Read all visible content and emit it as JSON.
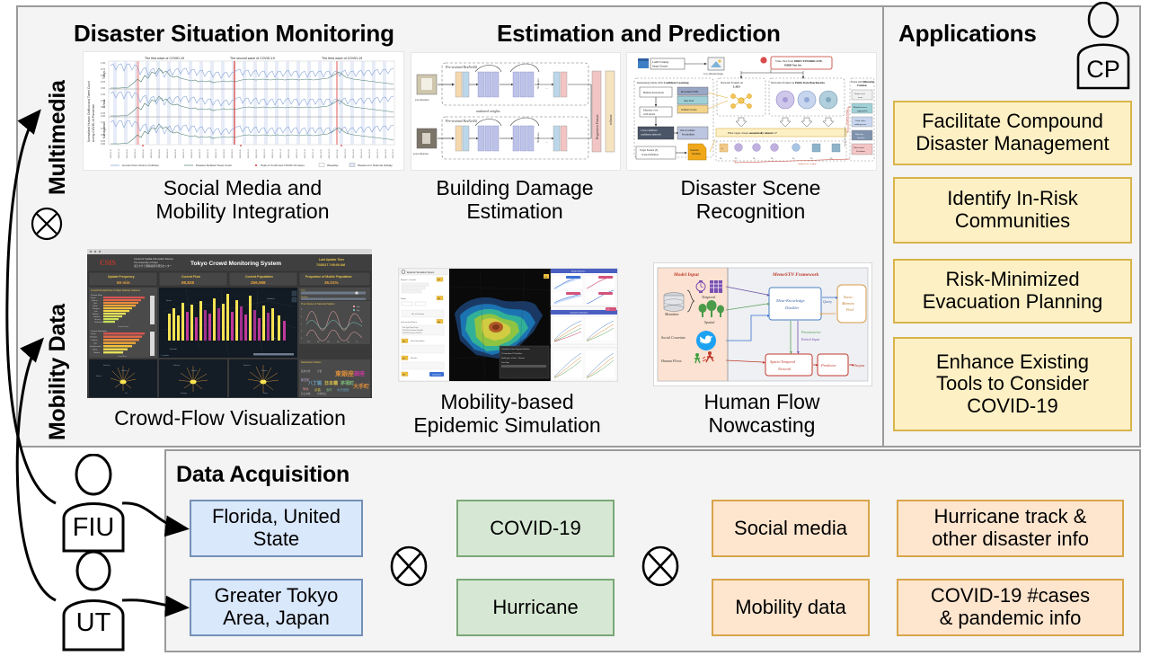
{
  "figure": {
    "side_labels": [
      {
        "id": "multimedia",
        "text": "Multimedia"
      },
      {
        "id": "mobility-data",
        "text": "Mobility Data"
      }
    ],
    "sections": {
      "monitoring_title": "Disaster Situation Monitoring",
      "estimation_title": "Estimation and Prediction",
      "applications_title": "Applications",
      "data_acquisition_title": "Data Acquisition"
    },
    "cards": [
      {
        "id": "social-media-mobility-integration",
        "caption": "Social Media and\nMobility Integration",
        "thumb": "timeseries-chart"
      },
      {
        "id": "building-damage-estimation",
        "caption": "Building Damage\nEstimation",
        "thumb": "resnet-siamese-diagram"
      },
      {
        "id": "disaster-scene-recognition",
        "caption": "Disaster Scene\nRecognition",
        "thumb": "scene-recognition-pipeline"
      },
      {
        "id": "crowd-flow-visualization",
        "caption": "Crowd-Flow Visualization",
        "thumb": "tokyo-crowd-dashboard"
      },
      {
        "id": "mobility-based-epidemic-simulation",
        "caption": "Mobility-based\nEpidemic Simulation",
        "thumb": "epidemic-simulation-ui"
      },
      {
        "id": "human-flow-nowcasting",
        "caption": "Human Flow\nNowcasting",
        "thumb": "memestn-framework"
      }
    ],
    "applications": [
      {
        "id": "facilitate-compound-disaster-management",
        "text": "Facilitate Compound\nDisaster Management"
      },
      {
        "id": "identify-in-risk-communities",
        "text": "Identify In-Risk\nCommunities"
      },
      {
        "id": "risk-minimized-evacuation-planning",
        "text": "Risk-Minimized\nEvacuation Planning"
      },
      {
        "id": "enhance-existing-tools",
        "text": "Enhance Existing\nTools to Consider\nCOVID-19"
      }
    ],
    "actors": [
      {
        "id": "cp",
        "label": "CP"
      },
      {
        "id": "fiu",
        "label": "FIU"
      },
      {
        "id": "ut",
        "label": "UT"
      }
    ],
    "data_acquisition": {
      "regions": [
        {
          "id": "florida",
          "text": "Florida, United\nState"
        },
        {
          "id": "greater-tokyo",
          "text": "Greater Tokyo\nArea, Japan"
        }
      ],
      "hazards": [
        {
          "id": "covid-19",
          "text": "COVID-19"
        },
        {
          "id": "hurricane",
          "text": "Hurricane"
        }
      ],
      "sources": [
        {
          "id": "social-media",
          "text": "Social media"
        },
        {
          "id": "mobility-data",
          "text": "Mobility data"
        }
      ],
      "contents": [
        {
          "id": "hurricane-track",
          "text": "Hurricane track &\nother disaster info"
        },
        {
          "id": "covid-cases",
          "text": "COVID-19 #cases\n& pandemic info"
        }
      ],
      "operators": [
        "cross-product-symbol",
        "cross-product-symbol"
      ]
    },
    "operators": {
      "multimedia_mobility": "cross-product-symbol"
    },
    "thumbnail_text": {
      "timeseries_chart": {
        "ylabel": "Normalized Human Outflow and Tweet Count during COVID-19 Pandemic",
        "wave_annotations": [
          "The first wave of COVID-19",
          "The second wave of COVID-19",
          "The third wave of COVID-19"
        ],
        "row_labels": [
          "Tokyo",
          "Chiba",
          "Kanagawa"
        ],
        "legend": [
          "Human Flow Volume (Outflow)",
          "Disaster-Related Tweet Count",
          "Peak of Confirmed COVID-19 Cases",
          "Weekday",
          "Weekend or National Holiday"
        ]
      },
      "resnet_diagram": {
        "blocks": [
          "Pre-trained ResNet50",
          "Pre-trained ResNet50"
        ],
        "inputs": [
          "pre-disaster",
          "post-disaster"
        ],
        "shared": "unshared weights",
        "outputs": [
          "Regression Feature",
          "softmax"
        ]
      },
      "scene_pipeline": {
        "nodes": [
          "LADI Training Image Dataset",
          "Denoising labels with Confident Learning",
          "Network Trained on LADI",
          "Networks Trained on Public Data Benchmarks",
          "Fusion with Differential Evolution",
          "Human Annotation",
          "Majority vote with labels",
          "Cross-validation confidence intervals",
          "Out-of-sample Probabilities",
          "Target Feature (F) Scene Definition",
          "Semantic Identifier",
          "Differential Evolution"
        ],
        "note": "Filter target classes semantically related to F"
      },
      "tokyo_dashboard": {
        "title": "Tokyo Crowd Monitoring System",
        "kpis": [
          {
            "label": "Update Frequency",
            "value": "60 min"
          },
          {
            "label": "Current Flow",
            "value": "89,828"
          },
          {
            "label": "Current Population",
            "value": "256,598"
          },
          {
            "label": "Proportion of Mobile Population",
            "value": "35.01%"
          }
        ],
        "last_update_label": "Last Update Time",
        "last_update_value": "7/3/2017 7:00:00 AM",
        "panels": [
          "Crowd Density/Flow of Major Railway Stations",
          "Time Series of Selected Station",
          "Destination Station"
        ]
      },
      "epidemic_sim": {
        "panels": [
          "map",
          "charts"
        ]
      },
      "memestn": {
        "left_title": "Model Input",
        "right_title": "MemeSTN Framework",
        "inputs": [
          "Metadata",
          "Temporal",
          "Spatial",
          "Social Covariate",
          "Human Flows"
        ],
        "nodes": [
          "Meta-Knowledge Distiller",
          "Socio-Memory Pool",
          "Spatio-Temporal Network",
          "Predictor",
          "Output"
        ],
        "edges": [
          "Query",
          "Parameterize",
          "Enrich Input"
        ]
      }
    }
  },
  "colors": {
    "yellow_fill": "#fdf0c4",
    "yellow_border": "#d8b44a",
    "blue_fill": "#dae8fc",
    "blue_border": "#7391b8",
    "green_fill": "#d6e8d4",
    "green_border": "#7aa876",
    "orange_fill": "#fde5ce",
    "orange_border": "#d8a44a",
    "panel_bg": "#f4f4f4",
    "panel_border": "#9a9a9a"
  }
}
